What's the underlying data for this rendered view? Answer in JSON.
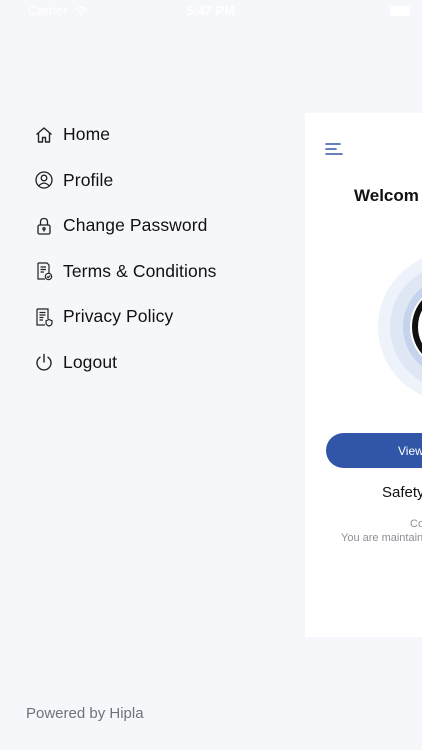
{
  "status_bar": {
    "carrier": "Carrier",
    "time": "5:47 PM"
  },
  "menu": {
    "items": [
      {
        "label": "Home",
        "icon": "home-icon"
      },
      {
        "label": "Profile",
        "icon": "user-icon"
      },
      {
        "label": "Change Password",
        "icon": "lock-icon"
      },
      {
        "label": "Terms & Conditions",
        "icon": "document-check-icon"
      },
      {
        "label": "Privacy Policy",
        "icon": "document-shield-icon"
      },
      {
        "label": "Logout",
        "icon": "power-icon"
      }
    ]
  },
  "footer": {
    "powered_by": "Powered by Hipla"
  },
  "main_card": {
    "welcome": "Welcom",
    "view_button": "View",
    "safety_text": "Safety",
    "small_line1": "Co",
    "small_line2": "You are maintain"
  },
  "colors": {
    "accent": "#3156a8",
    "background": "#f6f7fb",
    "ring_light": "#e4ebf7",
    "ring_mid": "#c9d5ec"
  }
}
